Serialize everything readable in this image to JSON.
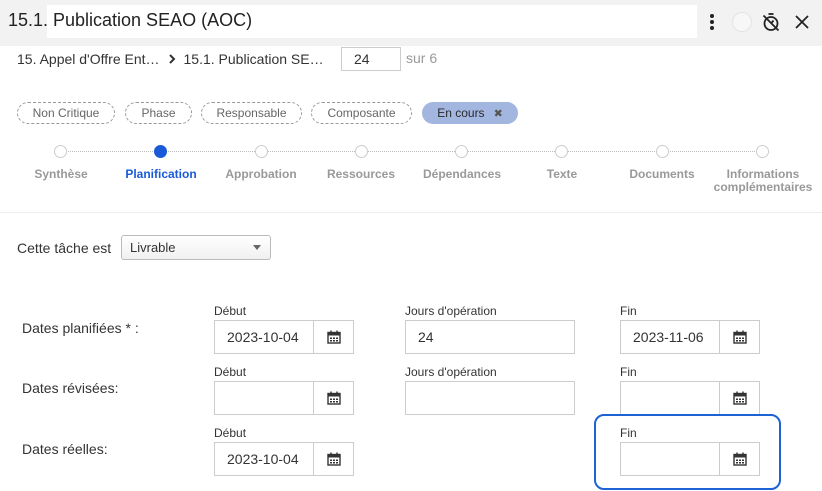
{
  "header": {
    "task_number": "15.1.",
    "title": "Publication SEAO (AOC)"
  },
  "breadcrumb": {
    "items": [
      "15. Appel d'Offre Ent…",
      "15.1. Publication SE…"
    ]
  },
  "pager": {
    "current": "24",
    "total": "sur 6"
  },
  "chips": [
    {
      "label": "Non Critique"
    },
    {
      "label": "Phase"
    },
    {
      "label": "Responsable"
    },
    {
      "label": "Composante"
    },
    {
      "label": "En cours",
      "active": true,
      "remove_icon": "close-x-icon"
    }
  ],
  "steps": [
    {
      "label": "Synthèse"
    },
    {
      "label": "Planification",
      "active": true
    },
    {
      "label": "Approbation"
    },
    {
      "label": "Ressources"
    },
    {
      "label": "Dépendances"
    },
    {
      "label": "Texte"
    },
    {
      "label": "Documents"
    },
    {
      "label": "Informations complémentaires"
    }
  ],
  "task_type": {
    "label": "Cette tâche est",
    "value": "Livrable"
  },
  "dates": {
    "planned": {
      "label": "Dates planifiées * :",
      "start_label": "Début",
      "start": "2023-10-04",
      "days_label": "Jours d'opération",
      "days": "24",
      "end_label": "Fin",
      "end": "2023-11-06"
    },
    "revised": {
      "label": "Dates révisées:",
      "start_label": "Début",
      "start": "",
      "days_label": "Jours d'opération",
      "days": "",
      "end_label": "Fin",
      "end": ""
    },
    "actual": {
      "label": "Dates réelles:",
      "start_label": "Début",
      "start": "2023-10-04",
      "end_label": "Fin",
      "end": ""
    }
  },
  "colors": {
    "accent": "#1a5ad8",
    "chip_active": "#a3b6e0",
    "highlight": "#1e63d6"
  },
  "icons": [
    "more-vertical-icon",
    "timer-off-icon",
    "close-icon",
    "chevron-right-icon",
    "calendar-icon"
  ]
}
